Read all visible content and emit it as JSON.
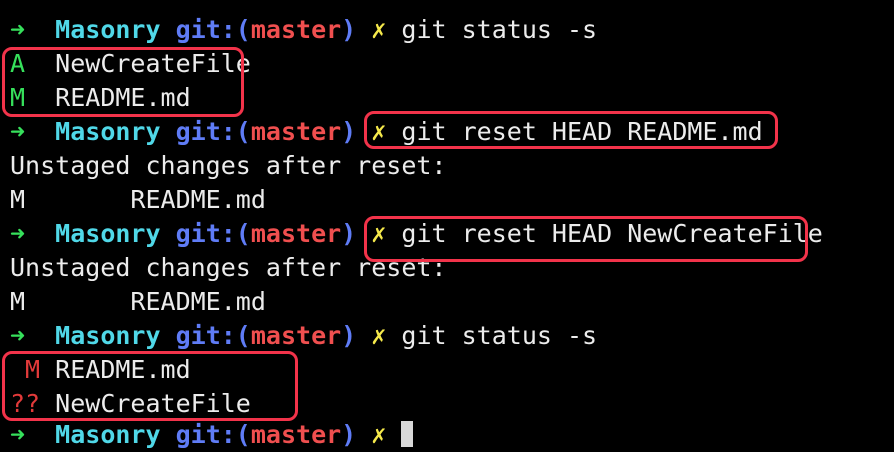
{
  "prompt": {
    "arrow": "➜",
    "dir": "Masonry",
    "git_open": "git:(",
    "branch": "master",
    "git_close": ")",
    "dirty": "✗"
  },
  "lines": {
    "l1_cmd": "git status -s",
    "l2_status": "A",
    "l2_file": "NewCreateFile",
    "l3_status": "M",
    "l3_file": "README.md",
    "l4_cmd": "git reset HEAD README.md",
    "l5_text": "Unstaged changes after reset:",
    "l6_status": "M",
    "l6_file": "README.md",
    "l7_cmd": "git reset HEAD NewCreateFile",
    "l8_text": "Unstaged changes after reset:",
    "l9_status": "M",
    "l9_file": "README.md",
    "l10_cmd": "git status -s",
    "l11_status": " M",
    "l11_file": "README.md",
    "l12_status": "??",
    "l12_file": "NewCreateFile"
  },
  "colors": {
    "background": "#000000",
    "arrow": "#36e05b",
    "dir": "#50d8e8",
    "git": "#5f7cf6",
    "branch": "#f04f4f",
    "dirty": "#f5e94b",
    "highlight": "#f2334a"
  }
}
